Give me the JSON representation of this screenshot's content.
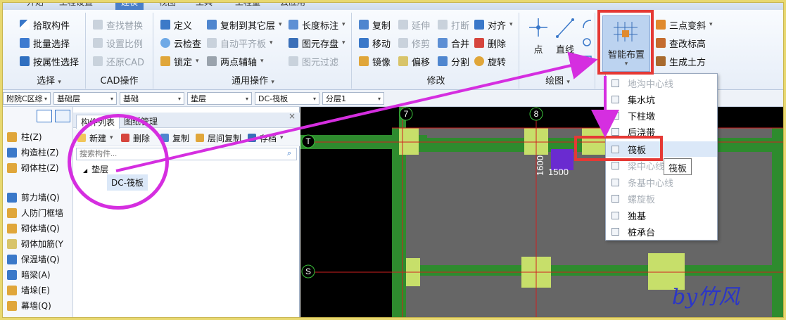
{
  "tabs": [
    "开始",
    "工程设置",
    "建模",
    "视图",
    "工具",
    "工程量",
    "云应用"
  ],
  "active_tab": 2,
  "select_group": {
    "label": "选择",
    "items": [
      "拾取构件",
      "批量选择",
      "按属性选择"
    ]
  },
  "cad_group": {
    "label": "CAD操作",
    "items": [
      "查找替换",
      "设置比例",
      "还原CAD"
    ]
  },
  "general_group": {
    "label": "通用操作",
    "col1": [
      "定义",
      "云检查",
      "锁定"
    ],
    "col2": [
      "复制到其它层",
      "自动平齐板",
      "两点辅轴"
    ],
    "col3": [
      "长度标注",
      "图元存盘",
      "图元过滤"
    ]
  },
  "modify_group": {
    "label": "修改",
    "col1": [
      "复制",
      "移动",
      "镜像"
    ],
    "col2": [
      "延伸",
      "修剪",
      "偏移"
    ],
    "col3": [
      "打断",
      "合并",
      "分割"
    ],
    "col4": [
      "对齐",
      "删除",
      "旋转"
    ]
  },
  "draw_group": {
    "label": "绘图",
    "point": "点",
    "line": "直线"
  },
  "smart_layout": {
    "label": "智能布置",
    "side": [
      "三点变斜",
      "查改标高",
      "生成土方"
    ]
  },
  "filter_bar": [
    "附院C区综",
    "基础层",
    "基础",
    "垫层",
    "DC-筏板",
    "分层1"
  ],
  "left_nav": [
    "柱(Z)",
    "构造柱(Z)",
    "砌体柱(Z)",
    "剪力墙(Q)",
    "人防门框墙",
    "砌体墙(Q)",
    "砌体加筋(Y",
    "保温墙(Q)",
    "暗梁(A)",
    "墙垛(E)",
    "幕墙(Q)"
  ],
  "panel": {
    "tabs": [
      "构件列表",
      "图纸管理"
    ],
    "toolbar": [
      "新建",
      "删除",
      "复制",
      "层间复制",
      "存档"
    ],
    "search_placeholder": "搜索构件...",
    "tree_root": "垫层",
    "tree_child": "DC-筏板"
  },
  "canvas": {
    "axis_labels": [
      "7",
      "8",
      "T",
      "S"
    ],
    "dim_vertical": "1600",
    "dim_horizontal": "1500"
  },
  "menu": {
    "items": [
      {
        "label": "地沟中心线",
        "enabled": false
      },
      {
        "label": "集水坑",
        "enabled": true
      },
      {
        "label": "下柱墩",
        "enabled": true
      },
      {
        "label": "后浇带",
        "enabled": true
      },
      {
        "label": "筏板",
        "enabled": true
      },
      {
        "label": "梁中心线",
        "enabled": false
      },
      {
        "label": "条基中心线",
        "enabled": false
      },
      {
        "label": "螺旋板",
        "enabled": false
      },
      {
        "label": "独基",
        "enabled": true
      },
      {
        "label": "桩承台",
        "enabled": true
      }
    ],
    "tooltip": "筏板"
  },
  "watermark": "by竹风",
  "colors": {
    "accent_red": "#e53935",
    "annotation_magenta": "#d52ee0",
    "canvas_bg": "#000000",
    "slab_gray": "#666666",
    "beam_green": "#2e8b2e",
    "column_lime": "#c7df6a",
    "selection_purple": "#6a2bd0"
  }
}
